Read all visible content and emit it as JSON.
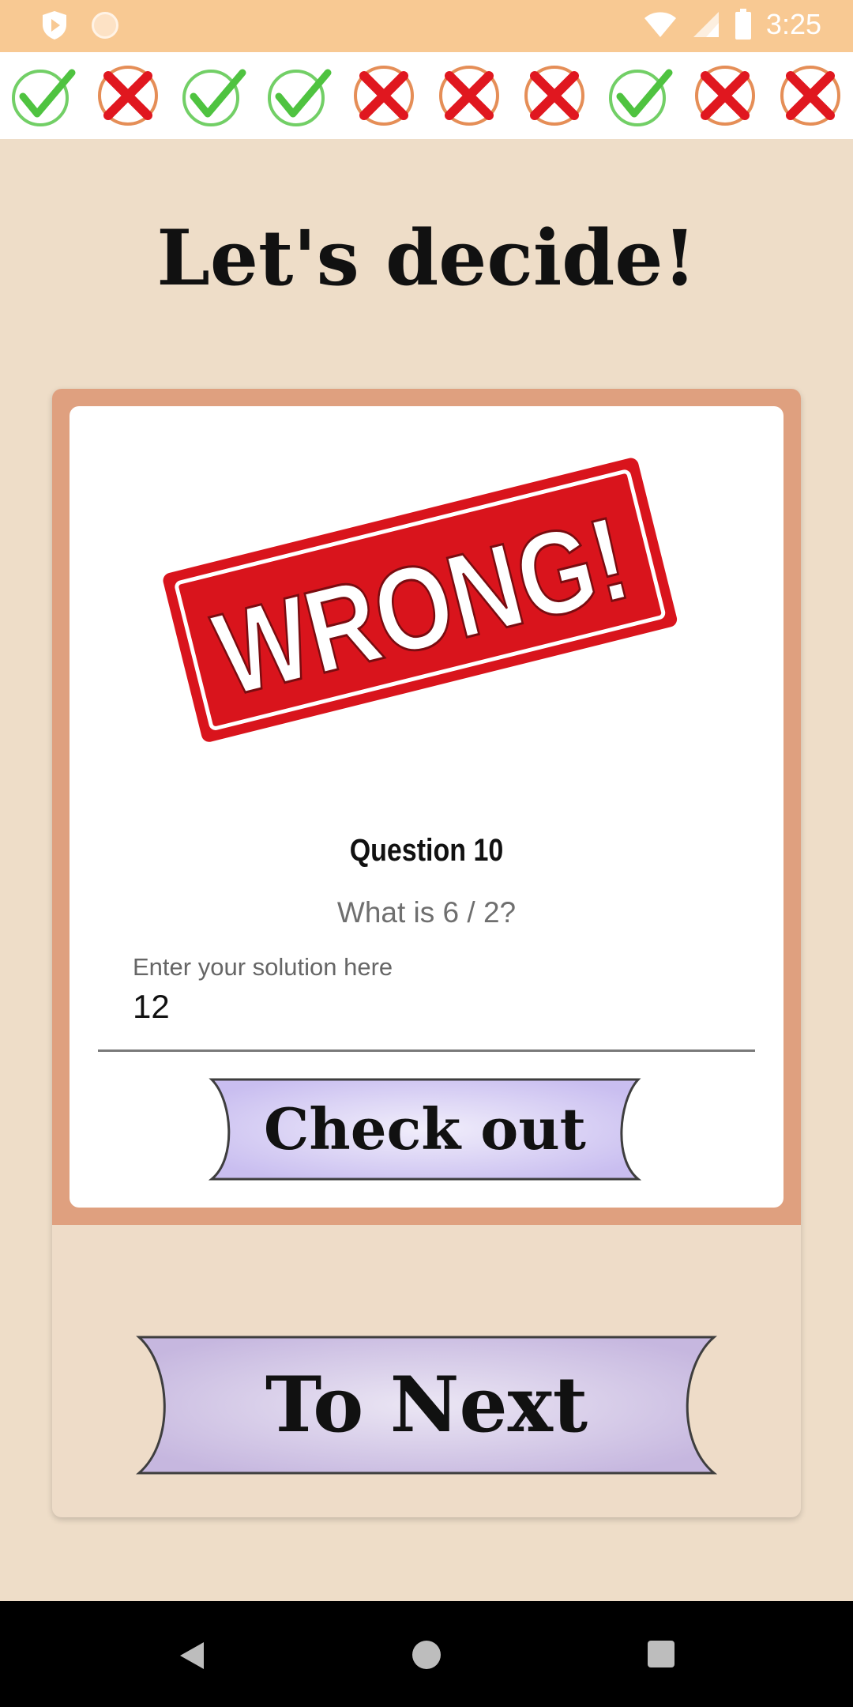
{
  "status_bar": {
    "time": "3:25",
    "icons": [
      "shield-icon",
      "circle-notification-icon",
      "wifi-icon",
      "signal-icon",
      "battery-icon"
    ]
  },
  "progress": {
    "results": [
      "correct",
      "wrong",
      "correct",
      "correct",
      "wrong",
      "wrong",
      "wrong",
      "correct",
      "wrong",
      "wrong"
    ]
  },
  "title": "Let's decide!",
  "feedback": {
    "stamp_text": "WRONG!",
    "stamp_color": "#e0171f"
  },
  "question": {
    "title": "Question 10",
    "text": "What is 6 / 2?",
    "input_label": "Enter your solution here",
    "input_value": "12"
  },
  "buttons": {
    "check_label": "Check out",
    "next_label": "To Next"
  },
  "colors": {
    "background": "#eeddc8",
    "frame": "#dfa07f",
    "banner_fill": "#d6cdf0",
    "correct": "#4fc340",
    "wrong": "#e0171f"
  },
  "nav": {
    "icons": [
      "back-icon",
      "home-icon",
      "recents-icon"
    ]
  }
}
